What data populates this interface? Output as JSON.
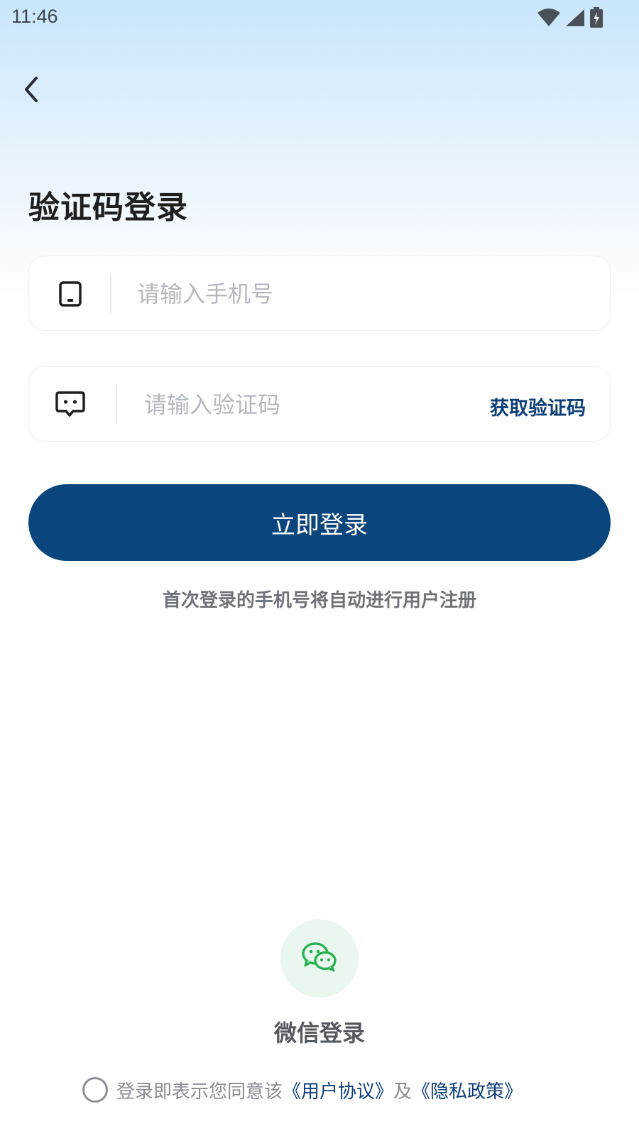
{
  "status_bar": {
    "time": "11:46"
  },
  "header": {
    "title": "验证码登录"
  },
  "form": {
    "phone_placeholder": "请输入手机号",
    "code_placeholder": "请输入验证码",
    "get_code_label": "获取验证码",
    "login_button_label": "立即登录",
    "hint": "首次登录的手机号将自动进行用户注册"
  },
  "wechat": {
    "label": "微信登录"
  },
  "agreement": {
    "prefix": "登录即表示您同意该",
    "user_agreement": "《用户协议》",
    "conjunction": "及",
    "privacy_policy": "《隐私政策》"
  },
  "colors": {
    "primary": "#0b457e",
    "link": "#0b3f78",
    "wechat_green": "#22b14c"
  },
  "icons": {
    "back": "back-arrow-icon",
    "phone": "phone-icon",
    "message": "message-icon",
    "wechat": "wechat-icon",
    "wifi": "wifi-icon",
    "signal": "signal-icon",
    "battery": "battery-charging-icon"
  }
}
